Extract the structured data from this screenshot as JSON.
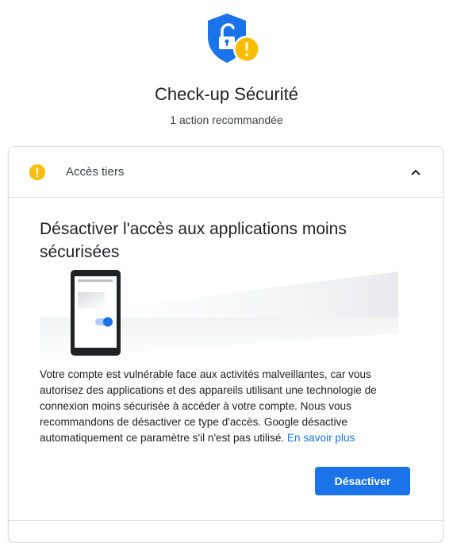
{
  "header": {
    "title": "Check-up Sécurité",
    "subtitle": "1 action recommandée",
    "icon": "shield-lock-warning-icon"
  },
  "card": {
    "section_label": "Accès tiers",
    "title": "Désactiver l'accès aux applications moins sécurisées",
    "description": "Votre compte est vulnérable face aux activités malveillantes, car vous autorisez des applications et des appareils utilisant une technologie de connexion moins sécurisée à accéder à votre compte. Nous vous recommandons de désactiver ce type d'accès. Google désactive automatiquement ce paramètre s'il n'est pas utilisé.",
    "learn_more": "En savoir plus",
    "action_label": "Désactiver",
    "expanded": true
  },
  "colors": {
    "shield_blue": "#1a73e8",
    "warning_yellow": "#fbbc04",
    "button_blue": "#1a73e8",
    "link_blue": "#1a73e8"
  }
}
